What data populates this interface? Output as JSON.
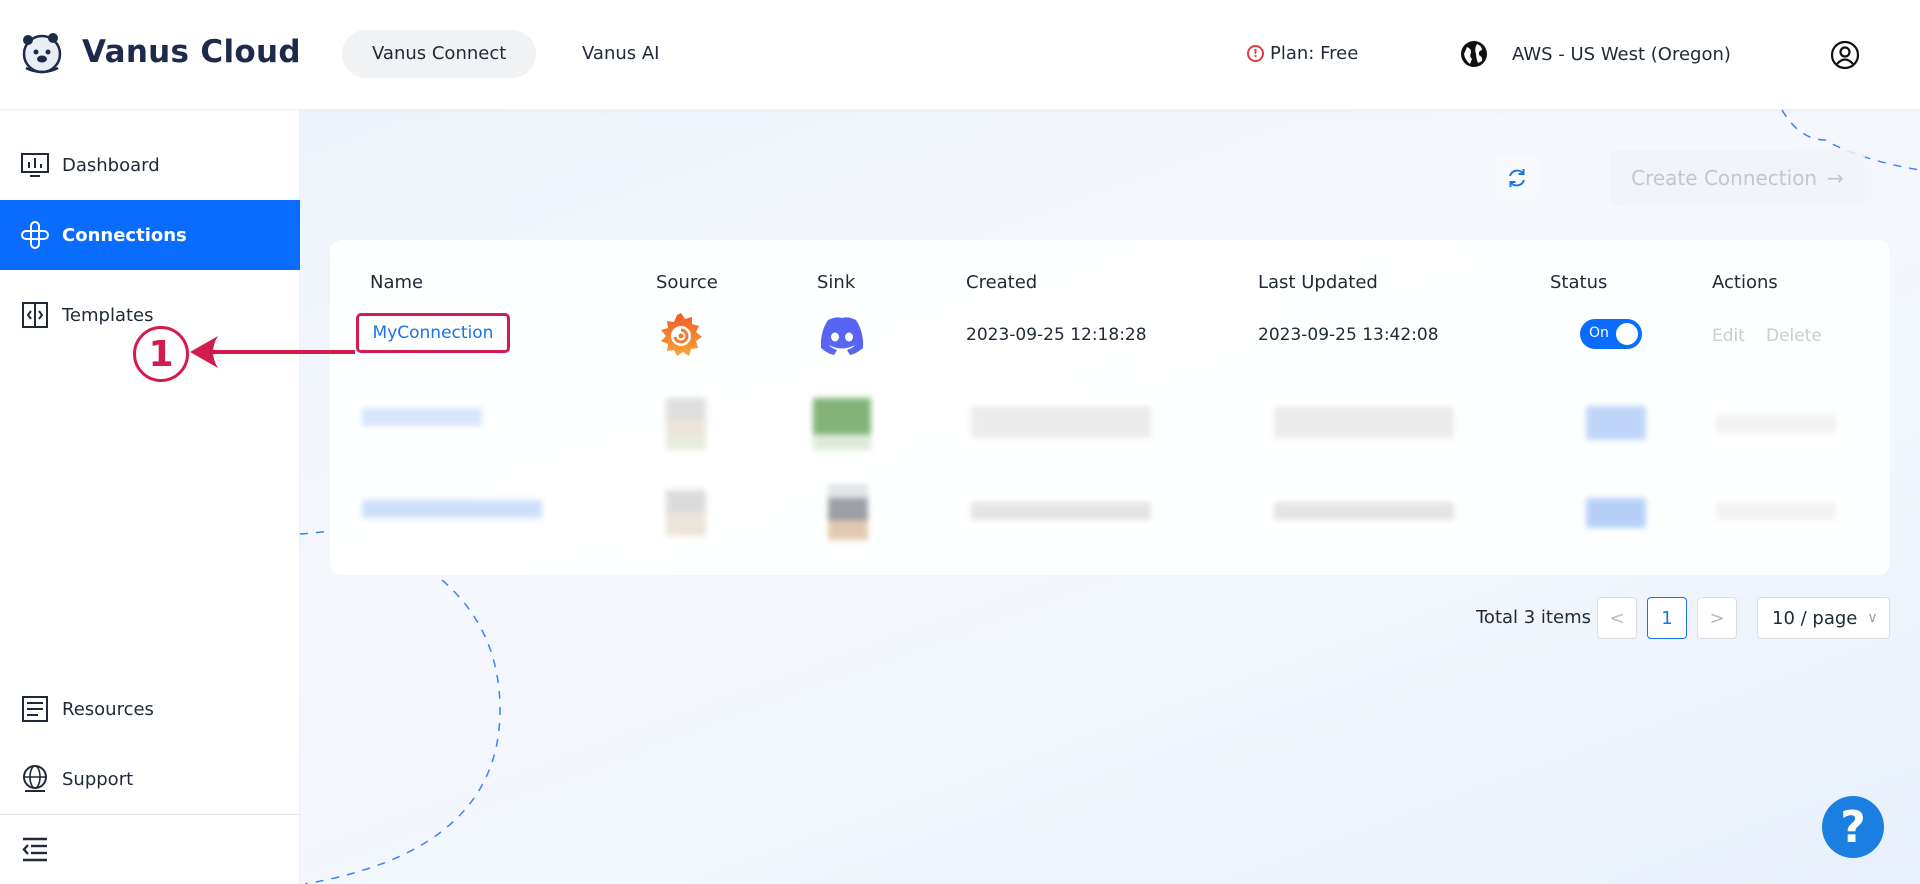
{
  "header": {
    "brand": "Vanus Cloud",
    "tabs": [
      {
        "label": "Vanus Connect",
        "active": true
      },
      {
        "label": "Vanus AI",
        "active": false
      }
    ],
    "plan": "Plan: Free",
    "plan_warning_icon": "!",
    "region": "AWS - US West (Oregon)"
  },
  "sidebar": {
    "items": [
      {
        "label": "Dashboard",
        "icon": "dashboard-icon"
      },
      {
        "label": "Connections",
        "icon": "connections-icon",
        "active": true
      },
      {
        "label": "Templates",
        "icon": "templates-icon"
      }
    ],
    "bottom_items": [
      {
        "label": "Resources",
        "icon": "resources-icon"
      },
      {
        "label": "Support",
        "icon": "support-icon"
      }
    ]
  },
  "toolbar": {
    "create_label": "Create Connection",
    "create_arrow": "→"
  },
  "table": {
    "columns": [
      "Name",
      "Source",
      "Sink",
      "Created",
      "Last Updated",
      "Status",
      "Actions"
    ],
    "rows": [
      {
        "name": "MyConnection",
        "source_icon": "grafana-icon",
        "sink_icon": "discord-icon",
        "created": "2023-09-25 12:18:28",
        "last_updated": "2023-09-25 13:42:08",
        "status": "On",
        "actions": [
          "Edit",
          "Delete"
        ]
      }
    ]
  },
  "pagination": {
    "total": "Total 3 items",
    "prev": "<",
    "current": "1",
    "next": ">",
    "per_page": "10 / page",
    "per_page_chevron": "∨"
  },
  "help": {
    "label": "?"
  },
  "annotation": {
    "step": "1"
  },
  "colors": {
    "accent": "#0a6cff",
    "link": "#1a73e8",
    "annotation": "#d21c4d",
    "brand_text": "#1e2a4a"
  }
}
